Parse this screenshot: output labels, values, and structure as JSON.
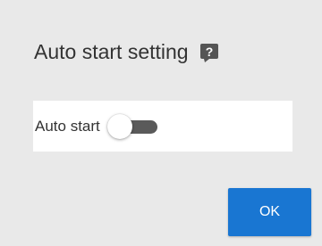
{
  "dialog": {
    "title": "Auto start setting",
    "help_icon": "help-icon",
    "auto_start": {
      "label": "Auto start",
      "enabled": false
    },
    "ok_label": "OK"
  },
  "colors": {
    "background": "#e9e9e9",
    "panel": "#ffffff",
    "accent": "#1976d2",
    "toggle_track_off": "#5a5a5a",
    "help_icon": "#555555"
  }
}
